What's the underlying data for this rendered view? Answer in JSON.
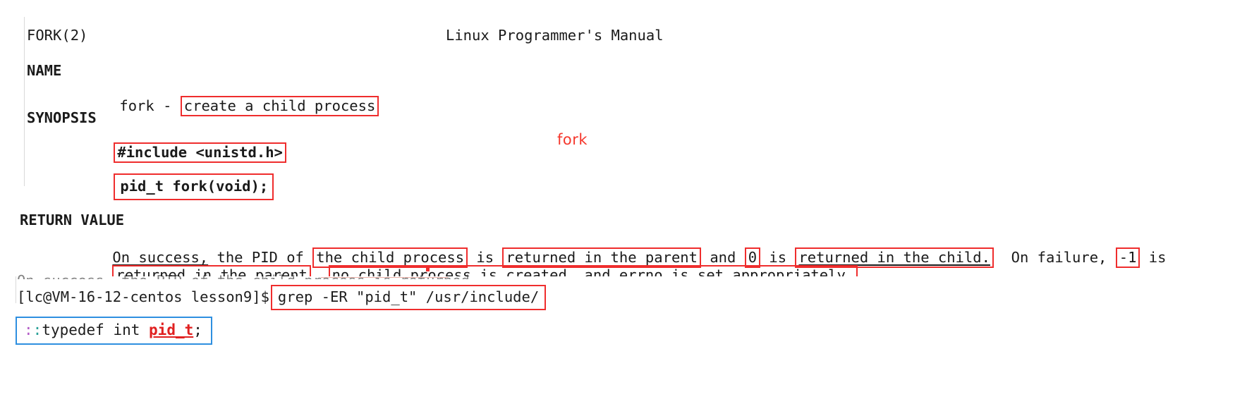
{
  "manpage": {
    "header": {
      "left": "FORK(2)",
      "center": "Linux Programmer's Manual"
    },
    "sections": [
      {
        "title": "NAME",
        "body_prefix": "fork - ",
        "boxed": "create a child process"
      },
      {
        "title": "SYNOPSIS",
        "line1": "#include <unistd.h>",
        "line2": "pid_t fork(void);"
      }
    ],
    "callout": "fork",
    "return_value": {
      "title": "RETURN VALUE",
      "line1": {
        "seg_on_success": "On success,",
        "seg_the_pid_of": " the PID of ",
        "box_child_process": "the child process",
        "seg_is_1": " is ",
        "box_returned_parent": "returned in the parent",
        "seg_and": " and ",
        "box_zero": "0",
        "seg_is_2": " is ",
        "box_returned_child": "returned in the child.",
        "seg_on_failure": "  On failure, ",
        "box_minus_one": "-1",
        "seg_is_3": " is"
      },
      "line2": {
        "box_returned_parent": "returned in the parent",
        "seg_comma": ", ",
        "box_rest_a": "no child process is created, and ",
        "box_rest_errno": "errno",
        "box_rest_b": " is set appropriately."
      }
    }
  },
  "terminal": {
    "ghost_row": "On success, the PID of the child process is returned",
    "prompt": "[lc@VM-16-12-centos lesson9]$",
    "command": "grep -ER \"pid_t\" /usr/include/",
    "result": {
      "path_prefix": ":",
      "colon": ":",
      "keyword": "typedef int ",
      "type_name": "pid_t",
      "semicolon": ";"
    }
  },
  "colors": {
    "annotation_red": "#ef2d2d",
    "callout_red": "#f5372c",
    "result_border_blue": "#2e8fe0",
    "pid_red": "#e02020",
    "text": "#1a1a1a"
  }
}
